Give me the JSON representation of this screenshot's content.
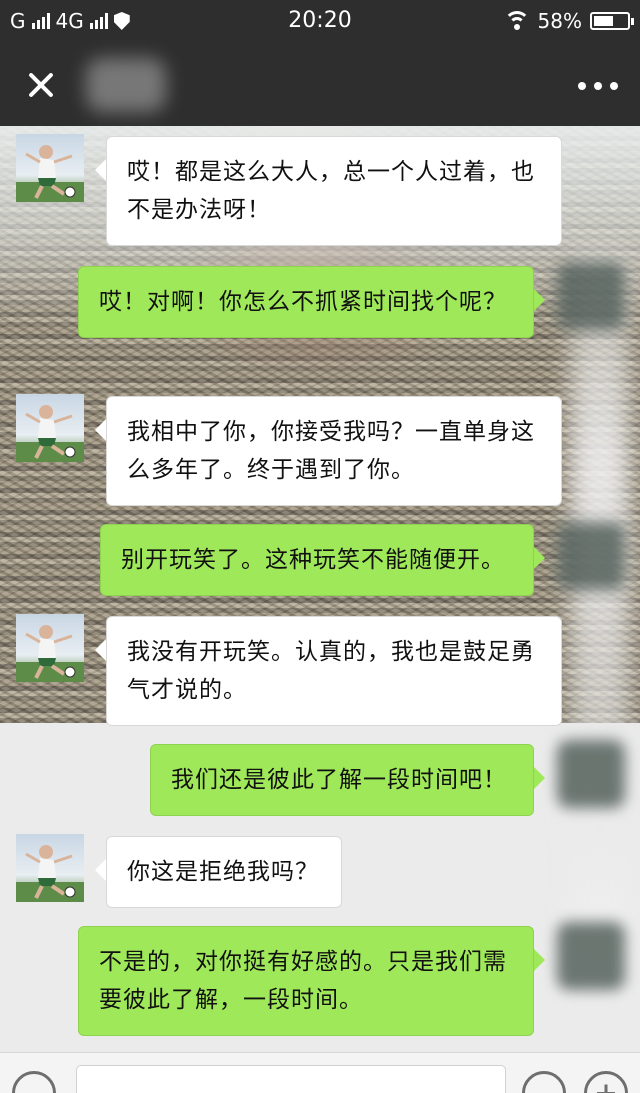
{
  "status_bar": {
    "carrier1": "G",
    "carrier2": "4G",
    "time": "20:20",
    "battery_text": "58%",
    "battery_level": 0.58
  },
  "header": {
    "contact_name": "",
    "icons": [
      "close-icon",
      "more-icon"
    ]
  },
  "messages": [
    {
      "side": "left",
      "text": "哎！都是这么大人，总一个人过着，也不是办法呀！"
    },
    {
      "side": "right",
      "text": "哎！对啊！你怎么不抓紧时间找个呢？"
    },
    {
      "side": "left",
      "text": "我相中了你，你接受我吗？一直单身这么多年了。终于遇到了你。"
    },
    {
      "side": "right",
      "text": "别开玩笑了。这种玩笑不能随便开。"
    },
    {
      "side": "left",
      "text": "我没有开玩笑。认真的，我也是鼓足勇气才说的。"
    },
    {
      "side": "right",
      "text": "我们还是彼此了解一段时间吧！"
    },
    {
      "side": "left",
      "text": "你这是拒绝我吗？"
    },
    {
      "side": "right",
      "text": "不是的，对你挺有好感的。只是我们需要彼此了解，一段时间。"
    }
  ],
  "input_bar": {
    "input_value": "",
    "icons": [
      "voice-icon",
      "emoji-icon",
      "plus-icon"
    ]
  },
  "colors": {
    "top_bar": "#2e2e2e",
    "bubble_sent": "#9fe859",
    "bubble_received": "#ffffff",
    "chat_background": "#ebebeb"
  }
}
